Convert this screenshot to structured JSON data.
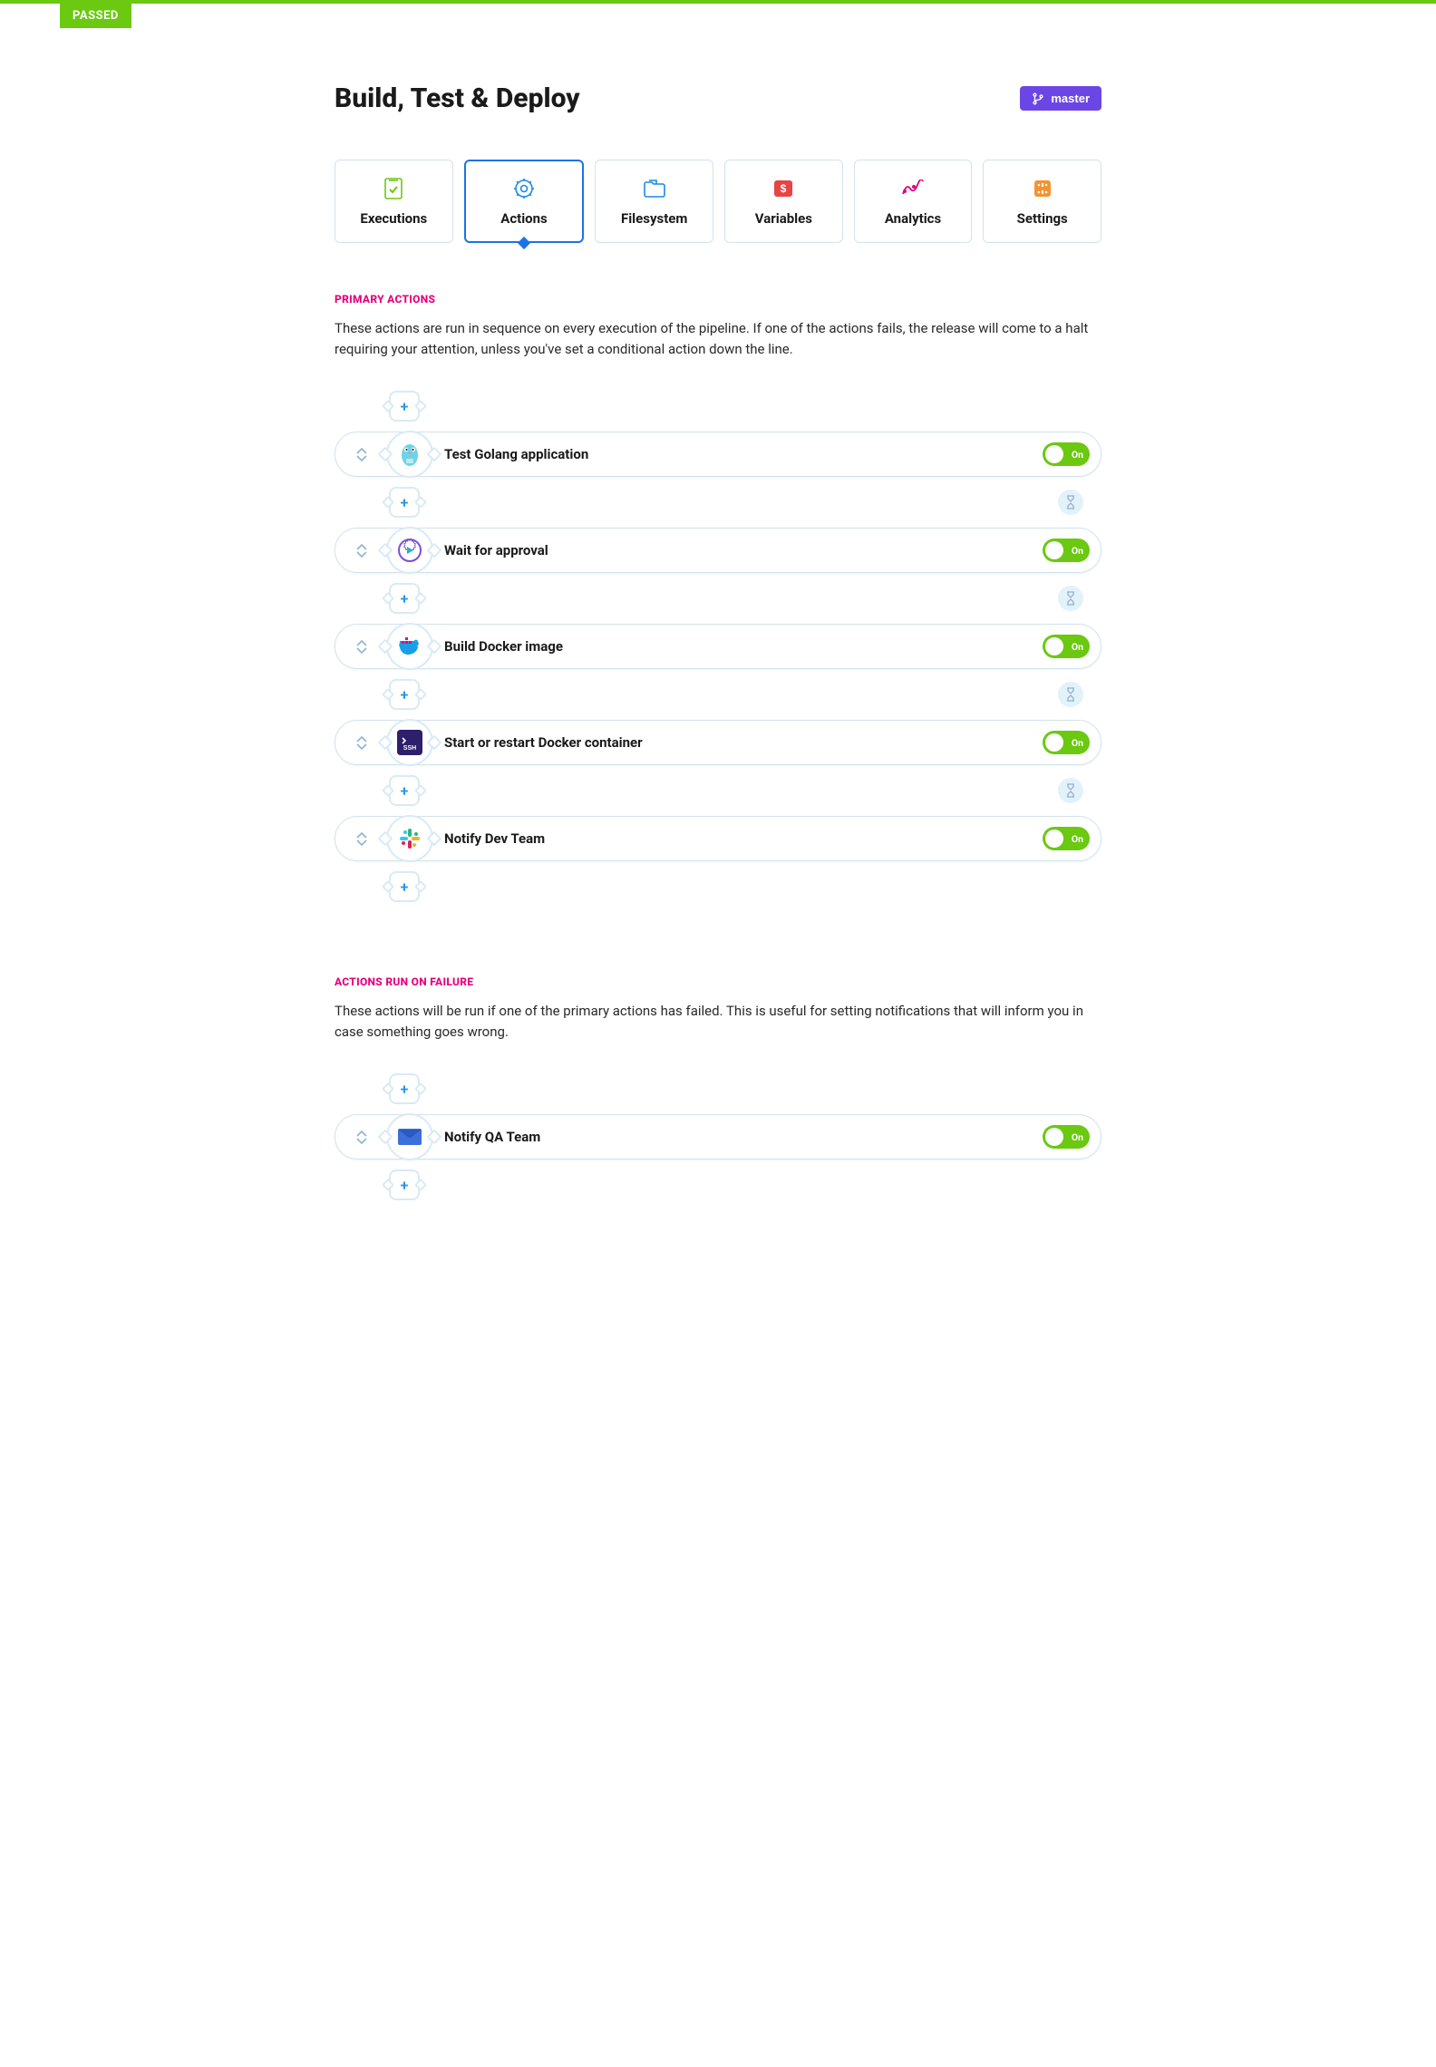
{
  "status_badge": "PASSED",
  "page_title": "Build, Test & Deploy",
  "branch": "master",
  "tabs": [
    {
      "label": "Executions"
    },
    {
      "label": "Actions"
    },
    {
      "label": "Filesystem"
    },
    {
      "label": "Variables"
    },
    {
      "label": "Analytics"
    },
    {
      "label": "Settings"
    }
  ],
  "primary": {
    "heading": "PRIMARY ACTIONS",
    "desc": "These actions are run in sequence on every execution of the pipeline. If one of the actions fails, the release will come to a halt requiring your attention, unless you've set a conditional action down the line.",
    "actions": [
      {
        "label": "Test Golang application",
        "toggle": "On",
        "icon": "golang"
      },
      {
        "label": "Wait for approval",
        "toggle": "On",
        "icon": "approval"
      },
      {
        "label": "Build Docker image",
        "toggle": "On",
        "icon": "docker"
      },
      {
        "label": "Start or restart Docker container",
        "toggle": "On",
        "icon": "ssh"
      },
      {
        "label": "Notify Dev Team",
        "toggle": "On",
        "icon": "slack"
      }
    ]
  },
  "failure": {
    "heading": "ACTIONS RUN ON FAILURE",
    "desc": "These actions will be run if one of the primary actions has failed. This is useful for setting notifications that will inform you in case something goes wrong.",
    "actions": [
      {
        "label": "Notify QA Team",
        "toggle": "On",
        "icon": "email"
      }
    ]
  }
}
